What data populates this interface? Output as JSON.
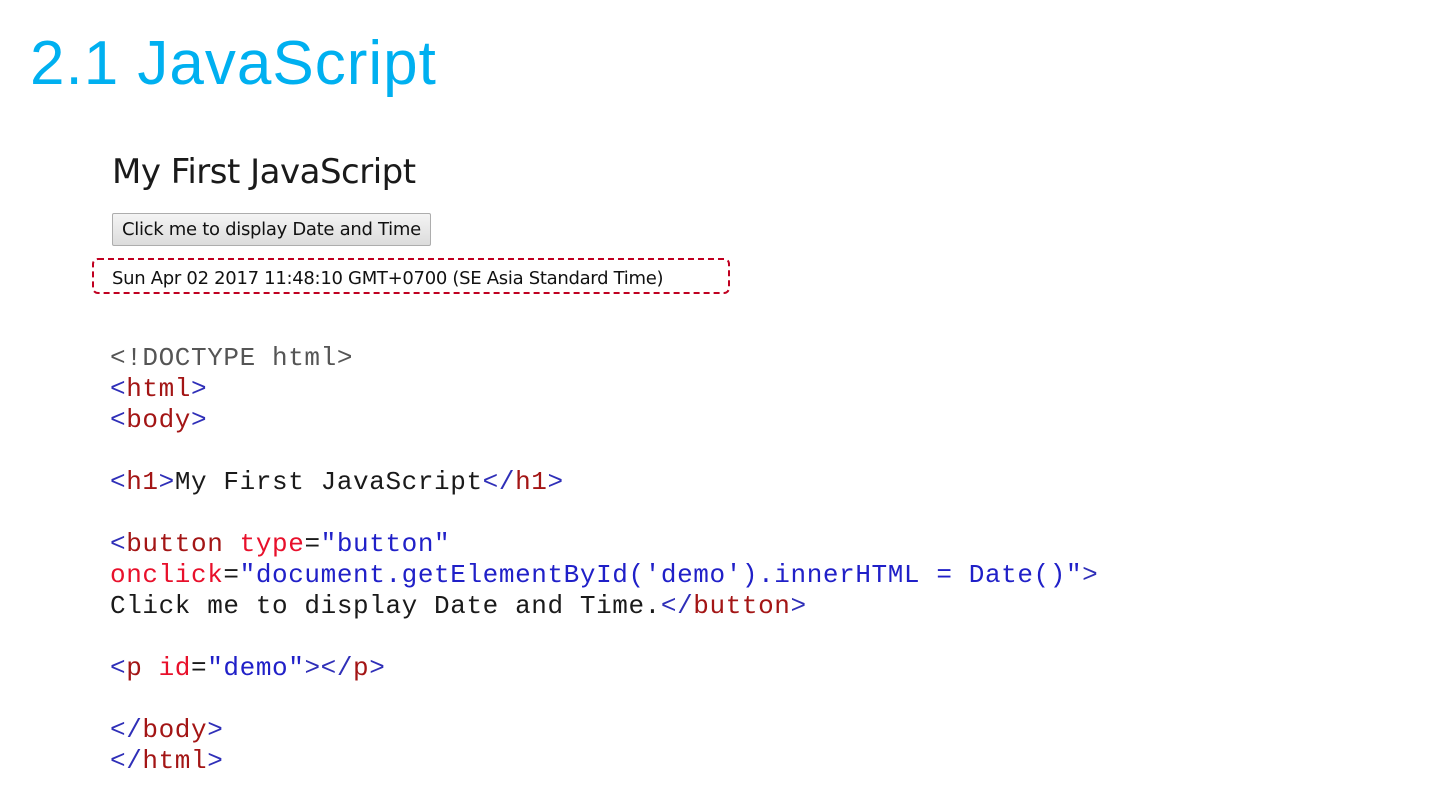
{
  "slide_title": "2.1 JavaScript",
  "preview": {
    "heading": "My First JavaScript",
    "button_label": "Click me to display Date and Time",
    "output_text": "Sun Apr 02 2017 11:48:10 GMT+0700 (SE Asia Standard Time)"
  },
  "colors": {
    "title": "#00b0f0",
    "bracket": "#2f2fb8",
    "tag": "#a31515",
    "attr": "#e8102b",
    "value": "#2020c8",
    "text": "#1a1a1a",
    "doctype": "#555555"
  },
  "code_lines": [
    [
      {
        "t": "<!DOCTYPE html>",
        "c": "doctype"
      }
    ],
    [
      {
        "t": "<",
        "c": "bracket"
      },
      {
        "t": "html",
        "c": "tag"
      },
      {
        "t": ">",
        "c": "bracket"
      }
    ],
    [
      {
        "t": "<",
        "c": "bracket"
      },
      {
        "t": "body",
        "c": "tag"
      },
      {
        "t": ">",
        "c": "bracket"
      }
    ],
    [],
    [
      {
        "t": "<",
        "c": "bracket"
      },
      {
        "t": "h1",
        "c": "tag"
      },
      {
        "t": ">",
        "c": "bracket"
      },
      {
        "t": "My First JavaScript",
        "c": "text"
      },
      {
        "t": "</",
        "c": "bracket"
      },
      {
        "t": "h1",
        "c": "tag"
      },
      {
        "t": ">",
        "c": "bracket"
      }
    ],
    [],
    [
      {
        "t": "<",
        "c": "bracket"
      },
      {
        "t": "button",
        "c": "tag"
      },
      {
        "t": " ",
        "c": "text"
      },
      {
        "t": "type",
        "c": "attr"
      },
      {
        "t": "=",
        "c": "text"
      },
      {
        "t": "\"button\"",
        "c": "value"
      }
    ],
    [
      {
        "t": "onclick",
        "c": "attr"
      },
      {
        "t": "=",
        "c": "text"
      },
      {
        "t": "\"document.getElementById('demo').innerHTML = Date()\"",
        "c": "value"
      },
      {
        "t": ">",
        "c": "bracket"
      }
    ],
    [
      {
        "t": "Click me to display Date and Time.",
        "c": "text"
      },
      {
        "t": "</",
        "c": "bracket"
      },
      {
        "t": "button",
        "c": "tag"
      },
      {
        "t": ">",
        "c": "bracket"
      }
    ],
    [],
    [
      {
        "t": "<",
        "c": "bracket"
      },
      {
        "t": "p",
        "c": "tag"
      },
      {
        "t": " ",
        "c": "text"
      },
      {
        "t": "id",
        "c": "attr"
      },
      {
        "t": "=",
        "c": "text"
      },
      {
        "t": "\"demo\"",
        "c": "value"
      },
      {
        "t": "></",
        "c": "bracket"
      },
      {
        "t": "p",
        "c": "tag"
      },
      {
        "t": ">",
        "c": "bracket"
      }
    ],
    [],
    [
      {
        "t": "</",
        "c": "bracket"
      },
      {
        "t": "body",
        "c": "tag"
      },
      {
        "t": ">",
        "c": "bracket"
      }
    ],
    [
      {
        "t": "</",
        "c": "bracket"
      },
      {
        "t": "html",
        "c": "tag"
      },
      {
        "t": ">",
        "c": "bracket"
      }
    ]
  ]
}
